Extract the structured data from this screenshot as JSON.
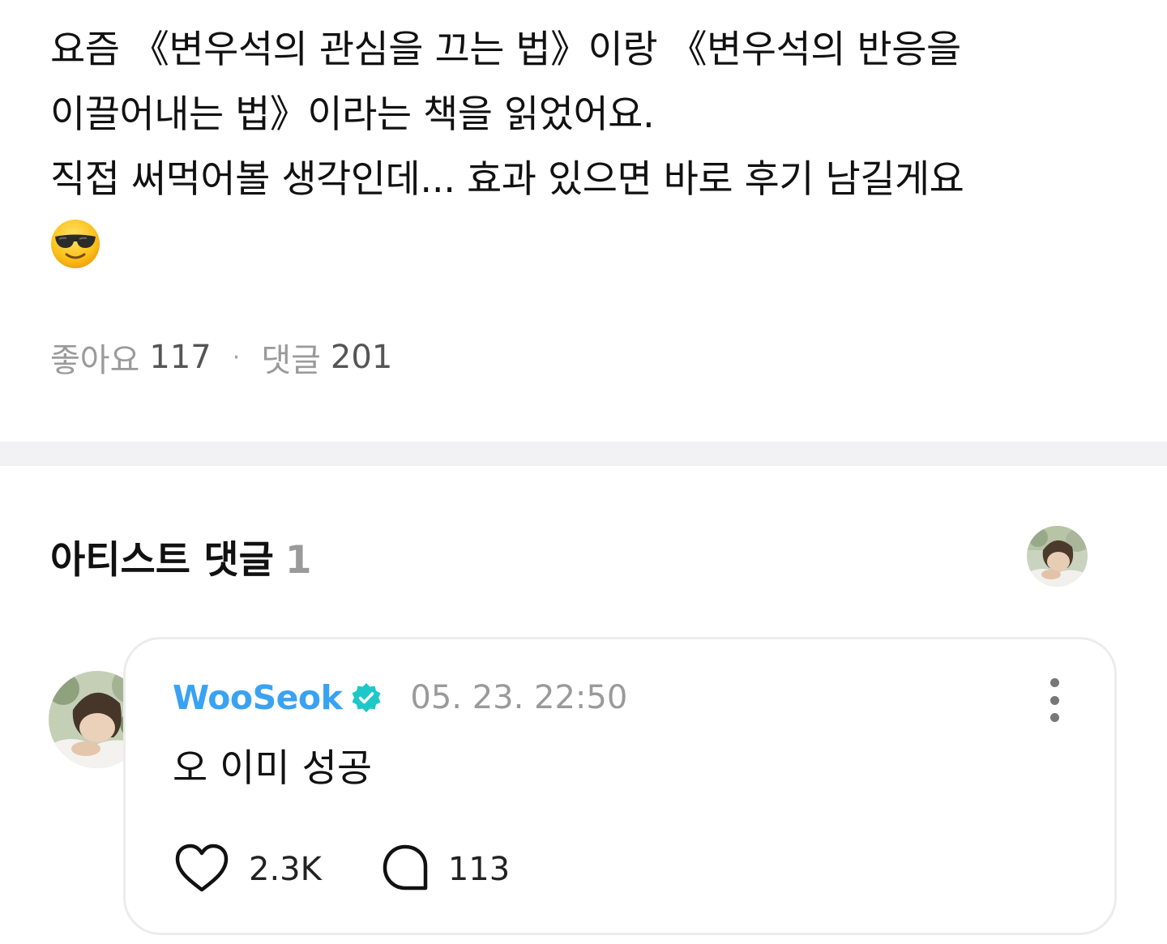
{
  "post": {
    "body_lines": [
      "요즘 《변우석의 관심을 끄는 법》이랑 《변우석의 반응을",
      "이끌어내는 법》이라는 책을 읽었어요.",
      "직접 써먹어볼 생각인데... 효과 있으면 바로 후기 남길게요"
    ],
    "emoji": "sunglasses-smiley",
    "likes_label": "좋아요",
    "likes_count": "117",
    "separator": "·",
    "comments_label": "댓글",
    "comments_count": "201"
  },
  "artist_comments": {
    "title": "아티스트 댓글",
    "count": "1",
    "comment": {
      "author": "WooSeok",
      "verified": true,
      "timestamp": "05. 23. 22:50",
      "text": "오 이미 성공",
      "like_count": "2.3K",
      "reply_count": "113"
    }
  },
  "colors": {
    "accent_blue": "#3aa2f2",
    "verified_teal": "#1ec8c8",
    "muted_text": "#9a9a9a",
    "divider": "#f2f2f4",
    "card_border": "#ececec"
  },
  "icons": [
    "sunglasses-emoji",
    "verified-badge-icon",
    "more-vertical-icon",
    "heart-icon",
    "comment-bubble-icon"
  ]
}
